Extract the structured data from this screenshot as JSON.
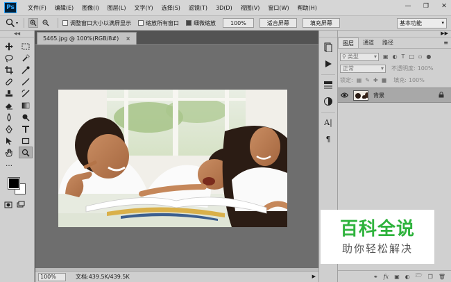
{
  "app": {
    "logo": "Ps",
    "menus": [
      "文件(F)",
      "编辑(E)",
      "图像(I)",
      "图层(L)",
      "文字(Y)",
      "选择(S)",
      "滤镜(T)",
      "3D(D)",
      "视图(V)",
      "窗口(W)",
      "帮助(H)"
    ],
    "window_controls": [
      "minimize-icon",
      "restore-icon",
      "close-icon"
    ]
  },
  "options": {
    "tool_icon": "zoom-icon",
    "resize_windows": "调整窗口大小以满屏显示",
    "resize_windows_checked": false,
    "zoom_all": "缩放所有窗口",
    "zoom_all_checked": false,
    "scrubby_zoom": "细微缩放",
    "scrubby_zoom_checked": true,
    "btn_100": "100%",
    "btn_fit": "适合屏幕",
    "btn_fill": "填充屏幕",
    "workspace": "基本功能"
  },
  "tools": {
    "icons": [
      "move-icon",
      "marquee-icon",
      "lasso-icon",
      "quick-select-icon",
      "crop-icon",
      "eyedropper-icon",
      "healing-icon",
      "brush-icon",
      "stamp-icon",
      "history-brush-icon",
      "eraser-icon",
      "gradient-icon",
      "blur-icon",
      "dodge-icon",
      "pen-icon",
      "type-icon",
      "path-select-icon",
      "rectangle-icon",
      "hand-icon",
      "zoom-icon"
    ],
    "active": "zoom-icon",
    "foreground": "#000000",
    "background": "#ffffff"
  },
  "document": {
    "tab_label": "5465.jpg @ 100%(RGB/8#)",
    "tab_close": "×",
    "zoom": "100%",
    "info": "文档:439.5K/439.5K"
  },
  "dock": {
    "icons": [
      "history-icon",
      "actions-icon",
      "properties-icon",
      "adjustments-icon",
      "character-icon",
      "paragraph-icon"
    ]
  },
  "layers": {
    "tabs": [
      "图层",
      "通道",
      "路径"
    ],
    "active_tab": "图层",
    "kind": "类型",
    "blend_mode": "正常",
    "opacity_label": "不透明度:",
    "opacity": "100%",
    "lock_label": "锁定:",
    "fill_label": "填充:",
    "fill": "100%",
    "items": [
      {
        "name": "背景",
        "visible": true,
        "locked": true
      }
    ],
    "footer_icons": [
      "link-icon",
      "fx-icon",
      "mask-icon",
      "adjustment-layer-icon",
      "group-icon",
      "new-layer-icon",
      "trash-icon"
    ]
  },
  "watermark": {
    "title": "百科全说",
    "subtitle": "助你轻松解决",
    "color": "#2fb33d"
  }
}
